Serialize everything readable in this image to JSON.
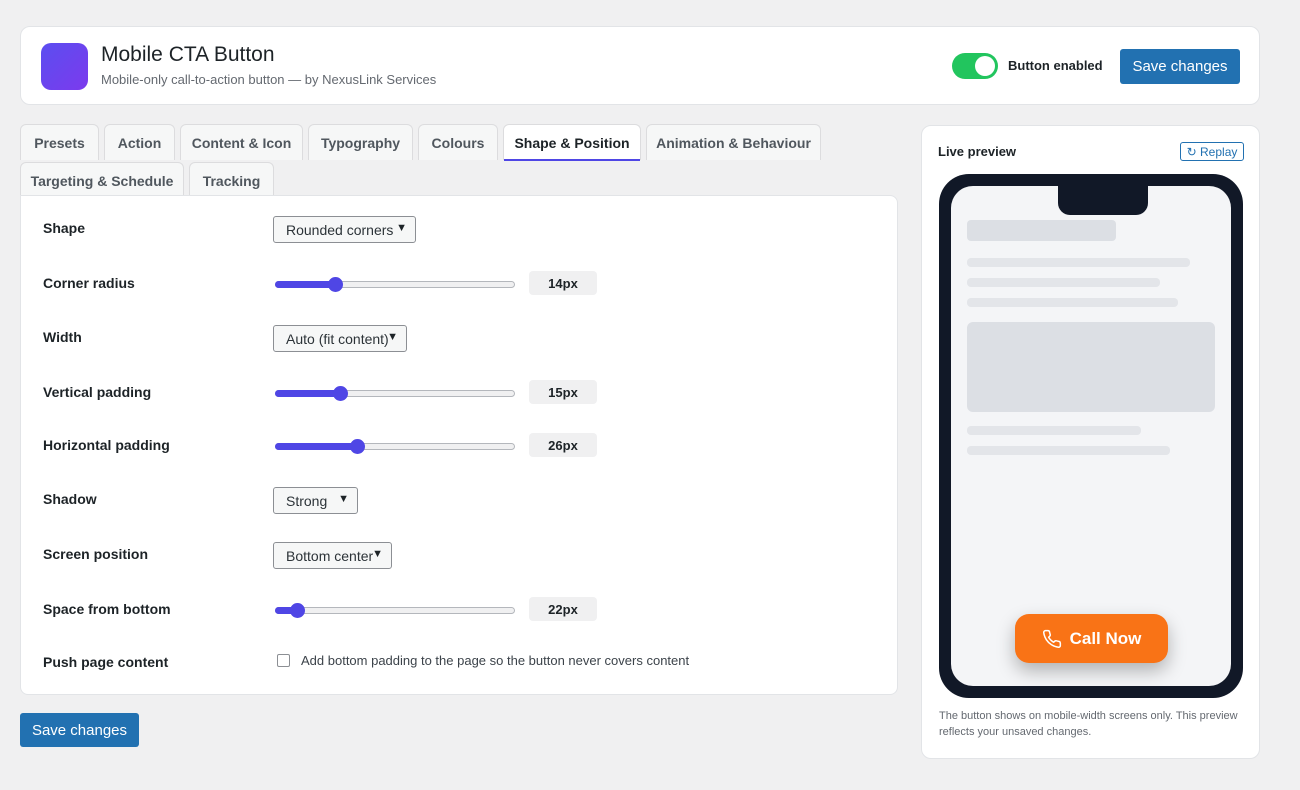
{
  "header": {
    "title": "Mobile CTA Button",
    "subtitle": "Mobile-only call-to-action button — by NexusLink Services",
    "toggle_label": "Button enabled",
    "toggle_on": true,
    "save_label": "Save changes"
  },
  "tabs": [
    {
      "label": "Presets",
      "active": false
    },
    {
      "label": "Action",
      "active": false
    },
    {
      "label": "Content & Icon",
      "active": false
    },
    {
      "label": "Typography",
      "active": false
    },
    {
      "label": "Colours",
      "active": false
    },
    {
      "label": "Shape & Position",
      "active": true
    },
    {
      "label": "Animation & Behaviour",
      "active": false
    },
    {
      "label": "Targeting & Schedule",
      "active": false
    },
    {
      "label": "Tracking",
      "active": false
    }
  ],
  "settings": {
    "shape": {
      "label": "Shape",
      "value": "Rounded corners"
    },
    "corner_radius": {
      "label": "Corner radius",
      "value": "14px",
      "fraction": 0.25
    },
    "width": {
      "label": "Width",
      "value": "Auto (fit content)"
    },
    "vertical_padding": {
      "label": "Vertical padding",
      "value": "15px",
      "fraction": 0.27
    },
    "horizontal_padding": {
      "label": "Horizontal padding",
      "value": "26px",
      "fraction": 0.34
    },
    "shadow": {
      "label": "Shadow",
      "value": "Strong"
    },
    "screen_position": {
      "label": "Screen position",
      "value": "Bottom center"
    },
    "space_from_bottom": {
      "label": "Space from bottom",
      "value": "22px",
      "fraction": 0.09
    },
    "push_content": {
      "label": "Push page content",
      "checkbox_label": "Add bottom padding to the page so the button never covers content",
      "checked": false
    }
  },
  "footer": {
    "save_label": "Save changes"
  },
  "preview": {
    "title": "Live preview",
    "replay_label": "↻ Replay",
    "cta_label": "Call Now",
    "cta_color": "#f97316",
    "note": "The button shows on mobile-width screens only. This preview reflects your unsaved changes."
  },
  "colors": {
    "accent": "#4f46e5",
    "wp_blue": "#2271b1",
    "toggle_green": "#22c55e"
  }
}
